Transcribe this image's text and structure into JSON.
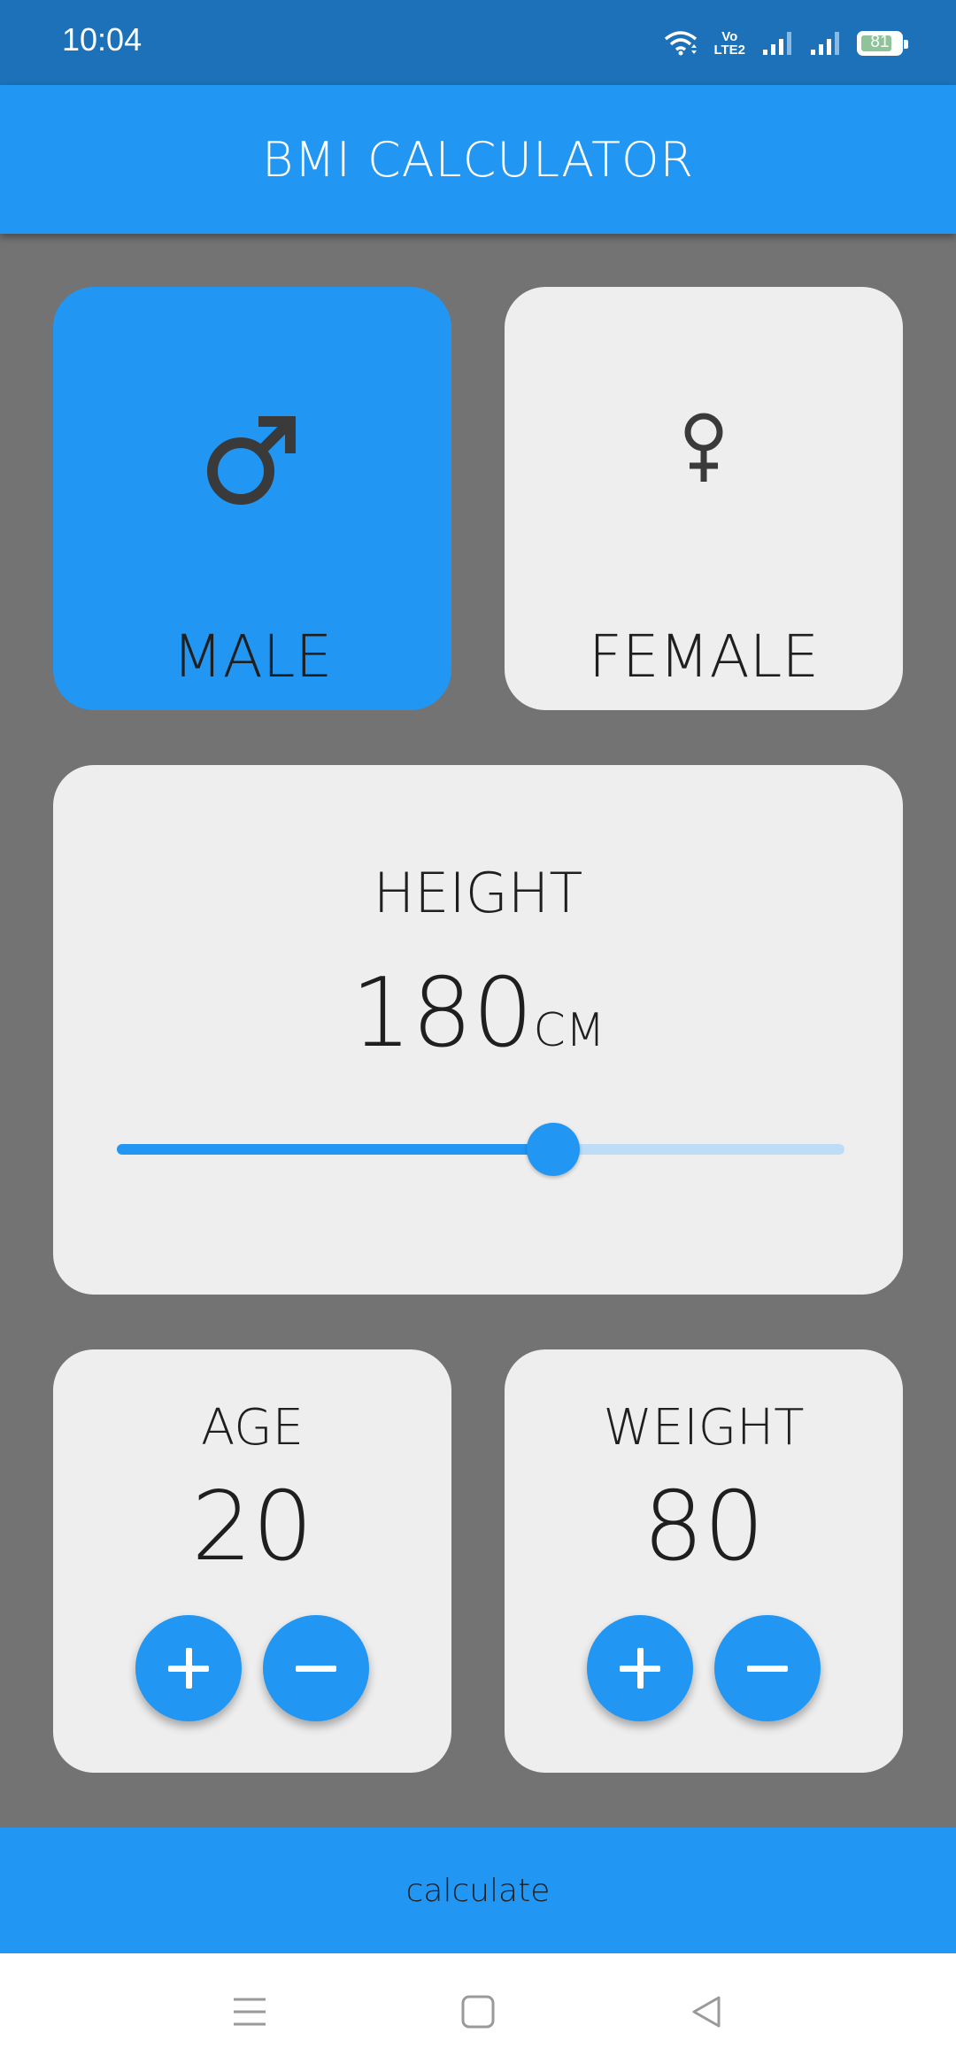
{
  "status_bar": {
    "time": "10:04",
    "volte_top": "Vo",
    "volte_bottom": "LTE2",
    "battery_level": "81",
    "icons": [
      "wifi-icon",
      "volte-icon",
      "signal-1-icon",
      "signal-2-icon",
      "battery-icon"
    ]
  },
  "app_bar": {
    "title": "BMI CALCULATOR"
  },
  "gender": {
    "male": {
      "label": "MALE",
      "icon": "male-icon",
      "selected": true
    },
    "female": {
      "label": "FEMALE",
      "icon": "female-icon",
      "selected": false
    }
  },
  "height": {
    "title": "HEIGHT",
    "value": "180",
    "unit": "CM",
    "slider_fraction": 0.6
  },
  "age": {
    "title": "AGE",
    "value": "20",
    "increment_icon": "plus-icon",
    "decrement_icon": "minus-icon"
  },
  "weight": {
    "title": "WEIGHT",
    "value": "80",
    "increment_icon": "plus-icon",
    "decrement_icon": "minus-icon"
  },
  "calculate": {
    "label": "calculate"
  },
  "nav_bar": {
    "icons": [
      "menu-icon",
      "home-icon",
      "back-icon"
    ]
  },
  "colors": {
    "accent": "#2296f3",
    "status_bar": "#1c71b9",
    "background": "#737373",
    "card": "#eeeeef",
    "text": "#1f1f1f"
  }
}
